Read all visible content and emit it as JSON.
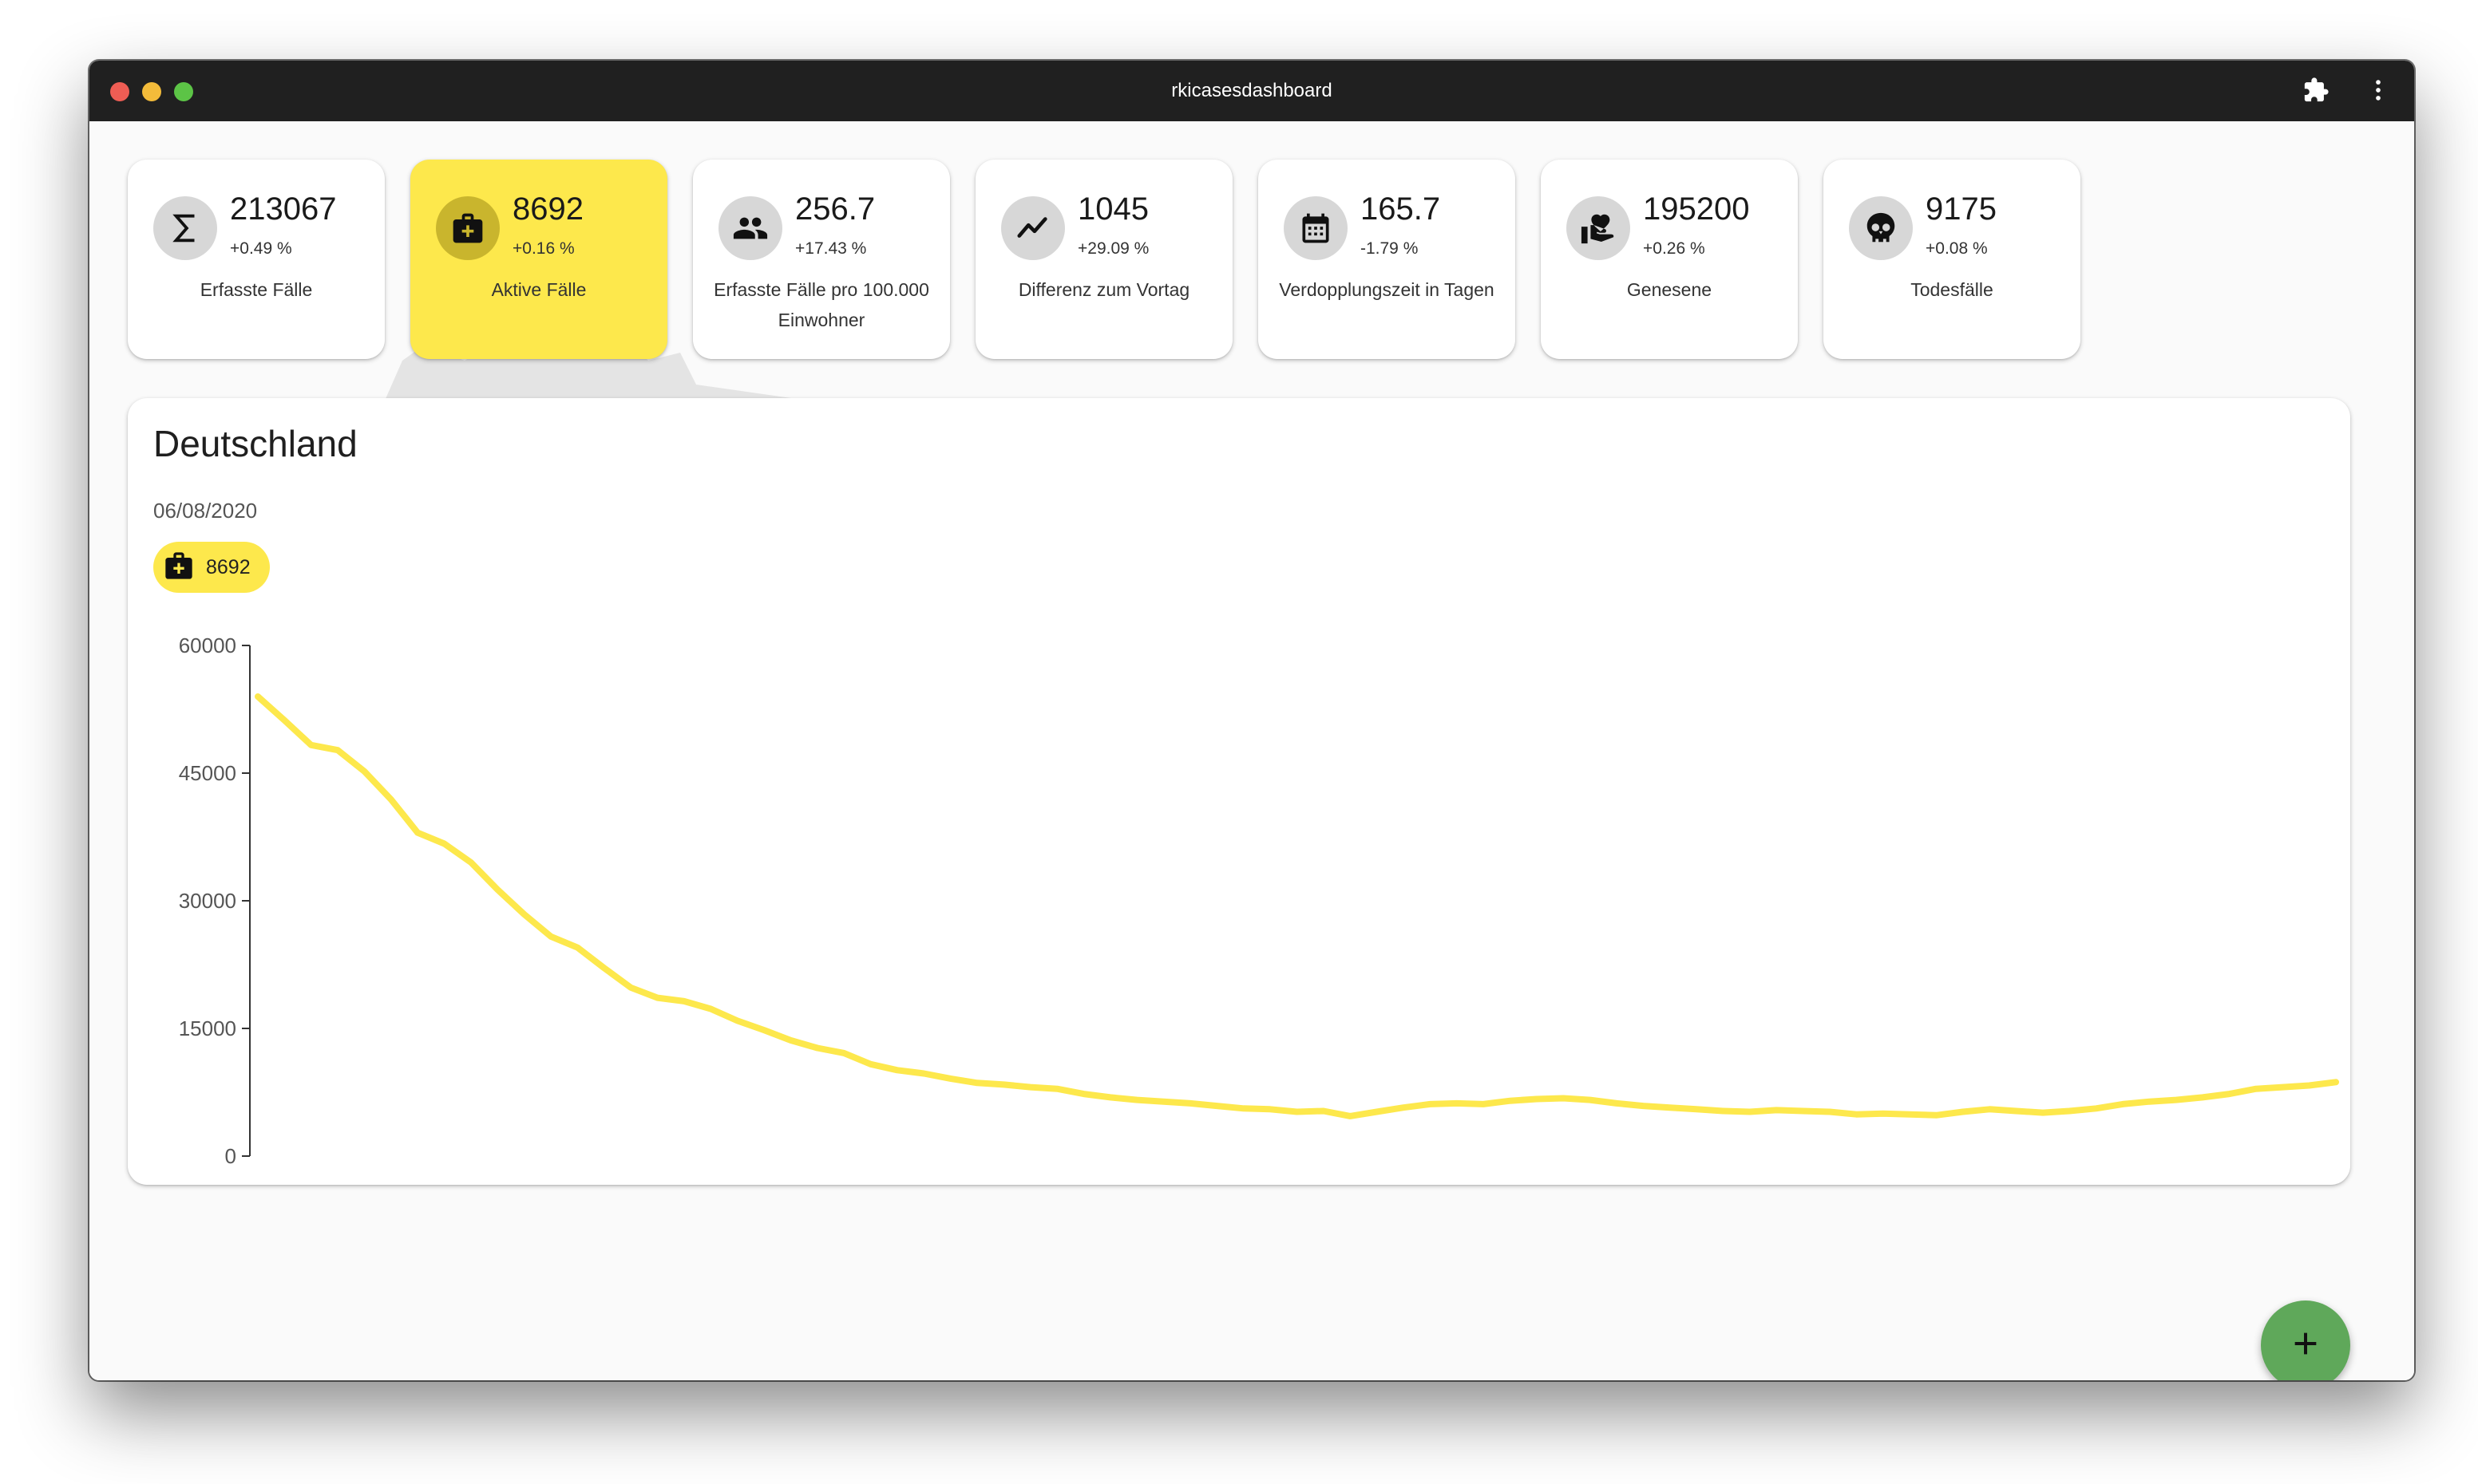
{
  "window": {
    "title": "rkicasesdashboard"
  },
  "toolbar": {
    "icons": [
      "puzzle-icon",
      "more-vert-icon"
    ]
  },
  "cards": [
    {
      "id": "erfasste-faelle",
      "icon": "sigma-icon",
      "value": "213067",
      "change": "+0.49 %",
      "label": "Erfasste Fälle",
      "active": false
    },
    {
      "id": "aktive-faelle",
      "icon": "medical-bag-icon",
      "value": "8692",
      "change": "+0.16 %",
      "label": "Aktive Fälle",
      "active": true
    },
    {
      "id": "faelle-pro-100000",
      "icon": "people-icon",
      "value": "256.7",
      "change": "+17.43 %",
      "label": "Erfasste Fälle pro 100.000 Einwohner",
      "active": false
    },
    {
      "id": "differenz-vortag",
      "icon": "trending-icon",
      "value": "1045",
      "change": "+29.09 %",
      "label": "Differenz zum Vortag",
      "active": false
    },
    {
      "id": "verdopplungszeit",
      "icon": "calendar-icon",
      "value": "165.7",
      "change": "-1.79 %",
      "label": "Verdopplungszeit in Tagen",
      "active": false
    },
    {
      "id": "genesene",
      "icon": "heart-hand-icon",
      "value": "195200",
      "change": "+0.26 %",
      "label": "Genesene",
      "active": false
    },
    {
      "id": "todesfaelle",
      "icon": "skull-icon",
      "value": "9175",
      "change": "+0.08 %",
      "label": "Todesfälle",
      "active": false
    }
  ],
  "main": {
    "title": "Deutschland",
    "date": "06/08/2020",
    "chip": {
      "icon": "medical-bag-icon",
      "value": "8692"
    }
  },
  "fab": {
    "icon": "plus-icon"
  },
  "colors": {
    "accent": "#fde84c",
    "fab": "#5fa85a",
    "line": "#fde84c"
  },
  "chart_data": {
    "type": "line",
    "title": "",
    "xlabel": "",
    "ylabel": "",
    "ylim": [
      0,
      60000
    ],
    "yticks": [
      "0",
      "15000",
      "30000",
      "45000",
      "60000"
    ],
    "grid": false,
    "series": [
      {
        "name": "",
        "values": [
          54000,
          51200,
          48300,
          47700,
          45200,
          41900,
          38000,
          36700,
          34500,
          31300,
          28400,
          25800,
          24500,
          22100,
          19800,
          18600,
          18200,
          17300,
          15900,
          14800,
          13600,
          12700,
          12100,
          10800,
          10100,
          9700,
          9100,
          8600,
          8400,
          8100,
          7900,
          7300,
          6900,
          6600,
          6400,
          6200,
          5900,
          5600,
          5500,
          5200,
          5300,
          4700,
          5200,
          5700,
          6100,
          6200,
          6100,
          6500,
          6700,
          6800,
          6600,
          6200,
          5900,
          5700,
          5500,
          5300,
          5200,
          5400,
          5300,
          5200,
          4900,
          5000,
          4900,
          4800,
          5200,
          5500,
          5300,
          5100,
          5300,
          5600,
          6100,
          6400,
          6600,
          6900,
          7300,
          7900,
          8100,
          8300,
          8692
        ]
      }
    ]
  }
}
